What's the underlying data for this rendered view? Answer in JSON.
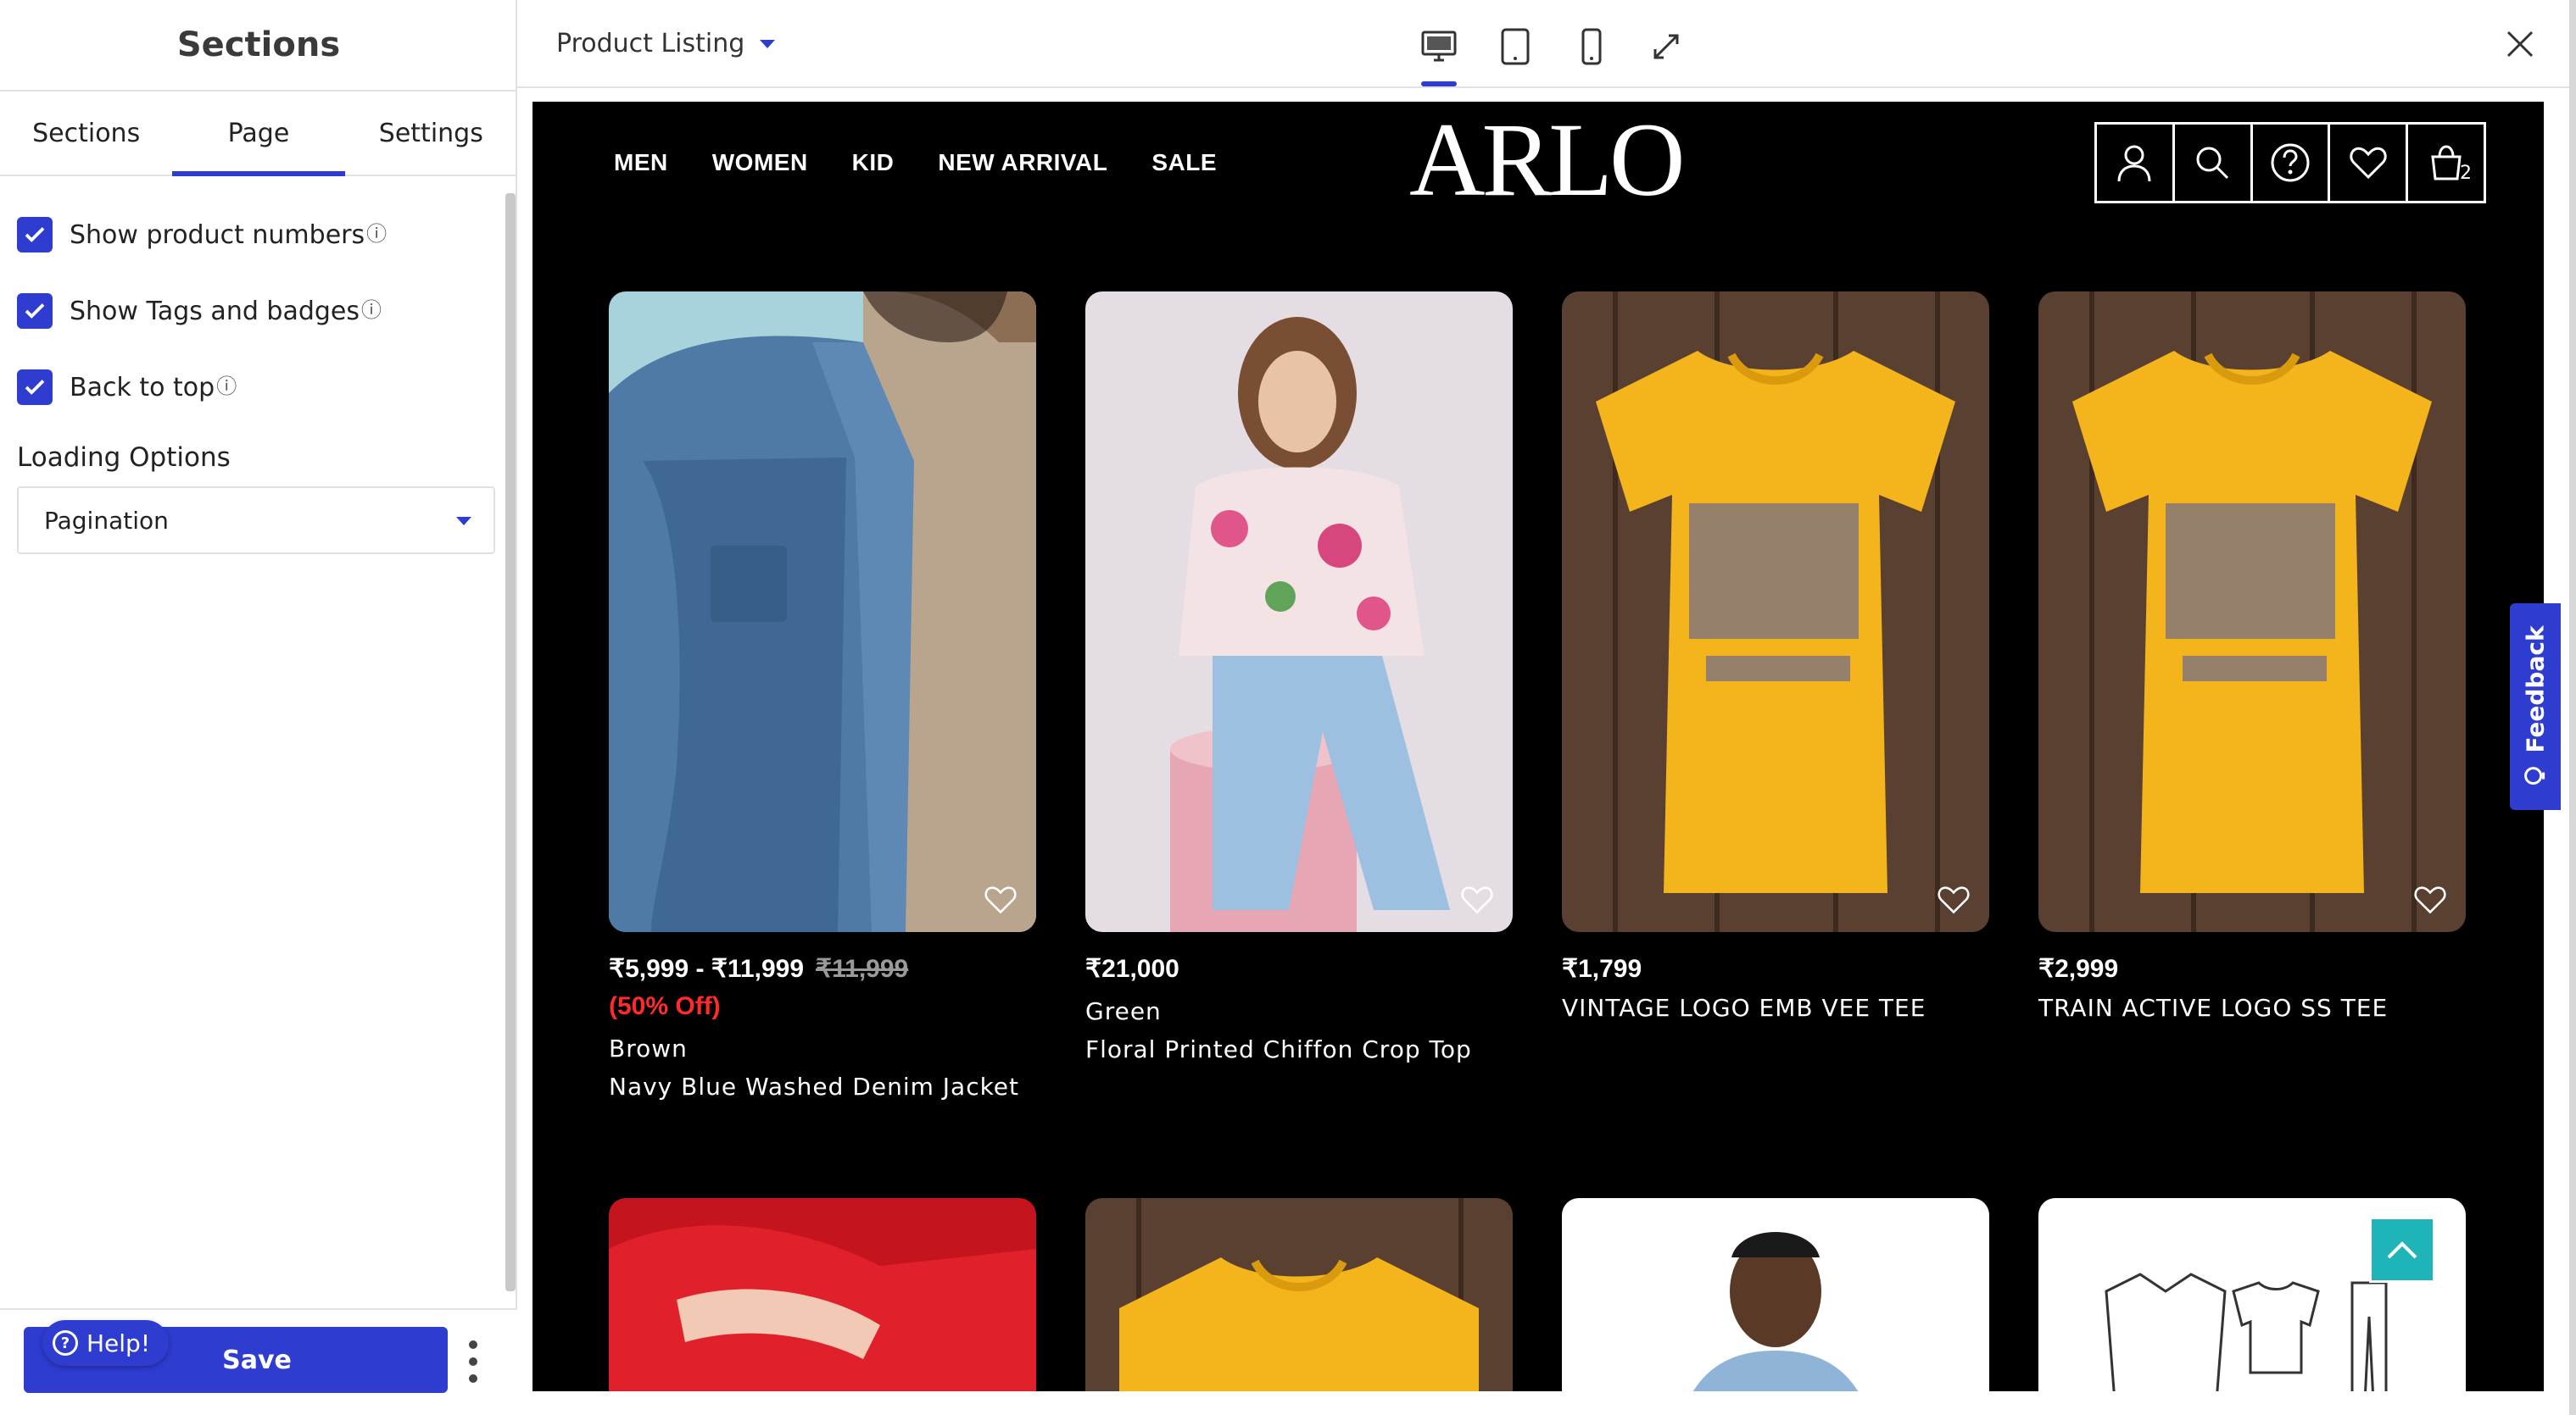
{
  "sidebar": {
    "title": "Sections",
    "tabs": [
      {
        "label": "Sections",
        "active": false
      },
      {
        "label": "Page",
        "active": true
      },
      {
        "label": "Settings",
        "active": false
      }
    ],
    "options": [
      {
        "label": "Show product numbers",
        "checked": true
      },
      {
        "label": "Show Tags and badges",
        "checked": true
      },
      {
        "label": "Back to top",
        "checked": true
      }
    ],
    "loading_label": "Loading Options",
    "loading_value": "Pagination",
    "save_label": "Save",
    "help_label": "Help!",
    "help_icon": "?",
    "info_glyph": "ⓘ"
  },
  "topbar": {
    "page_select": "Product Listing"
  },
  "store": {
    "nav": [
      "MEN",
      "WOMEN",
      "KID",
      "NEW ARRIVAL",
      "SALE"
    ],
    "logo": "ARLO",
    "cart_count": "2",
    "products": [
      {
        "price": "₹5,999 - ₹11,999",
        "original_price": "₹11,999",
        "discount": "(50% Off)",
        "variant": "Brown",
        "name": "Navy Blue Washed Denim Jacket"
      },
      {
        "price": "₹21,000",
        "variant": "Green",
        "name": "Floral Printed Chiffon Crop Top"
      },
      {
        "price": "₹1,799",
        "name": "VINTAGE LOGO EMB VEE TEE"
      },
      {
        "price": "₹2,999",
        "name": "TRAIN ACTIVE LOGO SS TEE"
      }
    ]
  },
  "feedback_label": "Feedback",
  "colors": {
    "accent": "#2e3ccf",
    "discount": "#ff2b2b",
    "back_to_top": "#1fb5b8",
    "store_bg": "#000000"
  }
}
